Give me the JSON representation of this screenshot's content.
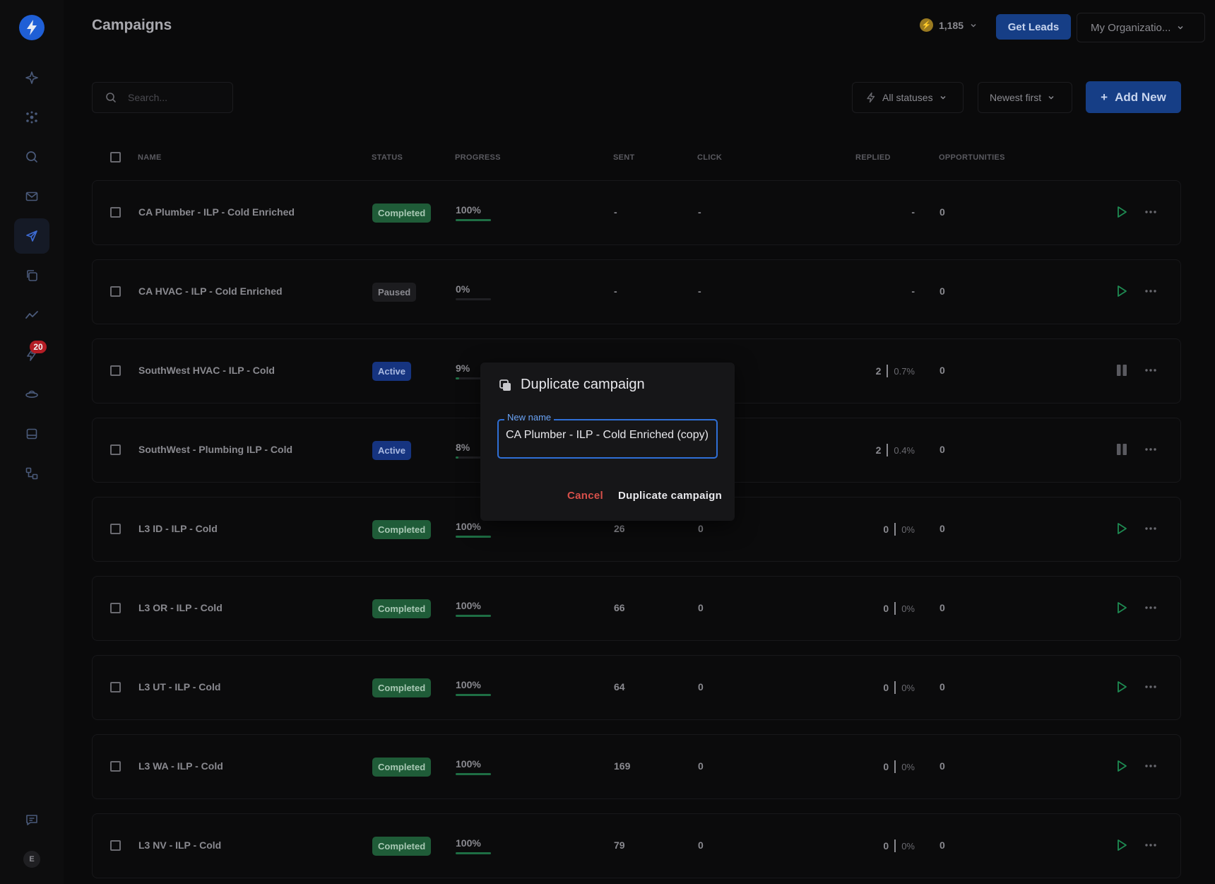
{
  "header": {
    "title": "Campaigns",
    "credits": "1,185",
    "get_leads_label": "Get Leads",
    "org_label": "My Organizatio..."
  },
  "sidebar": {
    "items": [
      {
        "icon": "sparkle-icon"
      },
      {
        "icon": "network-icon"
      },
      {
        "icon": "search-icon"
      },
      {
        "icon": "mail-icon"
      },
      {
        "icon": "send-icon",
        "active": true
      },
      {
        "icon": "copy-icon"
      },
      {
        "icon": "analytics-icon"
      },
      {
        "icon": "bolt-icon",
        "badge": "20"
      },
      {
        "icon": "ufo-icon"
      },
      {
        "icon": "inbox-icon"
      },
      {
        "icon": "workflow-icon"
      }
    ],
    "chat_icon": "chat-icon",
    "avatar_initial": "E"
  },
  "toolbar": {
    "search_placeholder": "Search...",
    "status_filter": "All statuses",
    "sort": "Newest first",
    "add_new_label": "Add New"
  },
  "table": {
    "columns": {
      "name": "NAME",
      "status": "STATUS",
      "progress": "PROGRESS",
      "sent": "SENT",
      "click": "CLICK",
      "replied": "REPLIED",
      "opportunities": "OPPORTUNITIES"
    },
    "rows": [
      {
        "name": "CA Plumber - ILP - Cold Enriched",
        "status": "Completed",
        "status_kind": "completed",
        "progress": "100%",
        "progress_value": 100,
        "sent": "-",
        "click": "-",
        "replied": "-",
        "replied_pct": "",
        "opportunities": "0",
        "action": "play"
      },
      {
        "name": "CA HVAC - ILP - Cold Enriched",
        "status": "Paused",
        "status_kind": "paused",
        "progress": "0%",
        "progress_value": 0,
        "sent": "-",
        "click": "-",
        "replied": "-",
        "replied_pct": "",
        "opportunities": "0",
        "action": "play"
      },
      {
        "name": "SouthWest HVAC - ILP - Cold",
        "status": "Active",
        "status_kind": "active",
        "progress": "9%",
        "progress_value": 9,
        "sent": "",
        "click": "",
        "replied": "2",
        "replied_pct": "0.7%",
        "opportunities": "0",
        "action": "pause"
      },
      {
        "name": "SouthWest - Plumbing ILP - Cold",
        "status": "Active",
        "status_kind": "active",
        "progress": "8%",
        "progress_value": 8,
        "sent": "",
        "click": "",
        "replied": "2",
        "replied_pct": "0.4%",
        "opportunities": "0",
        "action": "pause"
      },
      {
        "name": "L3 ID - ILP - Cold",
        "status": "Completed",
        "status_kind": "completed",
        "progress": "100%",
        "progress_value": 100,
        "sent": "26",
        "click": "0",
        "replied": "0",
        "replied_pct": "0%",
        "opportunities": "0",
        "action": "play"
      },
      {
        "name": "L3 OR - ILP - Cold",
        "status": "Completed",
        "status_kind": "completed",
        "progress": "100%",
        "progress_value": 100,
        "sent": "66",
        "click": "0",
        "replied": "0",
        "replied_pct": "0%",
        "opportunities": "0",
        "action": "play"
      },
      {
        "name": "L3 UT - ILP - Cold",
        "status": "Completed",
        "status_kind": "completed",
        "progress": "100%",
        "progress_value": 100,
        "sent": "64",
        "click": "0",
        "replied": "0",
        "replied_pct": "0%",
        "opportunities": "0",
        "action": "play"
      },
      {
        "name": "L3 WA - ILP - Cold",
        "status": "Completed",
        "status_kind": "completed",
        "progress": "100%",
        "progress_value": 100,
        "sent": "169",
        "click": "0",
        "replied": "0",
        "replied_pct": "0%",
        "opportunities": "0",
        "action": "play"
      },
      {
        "name": "L3 NV - ILP - Cold",
        "status": "Completed",
        "status_kind": "completed",
        "progress": "100%",
        "progress_value": 100,
        "sent": "79",
        "click": "0",
        "replied": "0",
        "replied_pct": "0%",
        "opportunities": "0",
        "action": "play"
      }
    ]
  },
  "modal": {
    "title": "Duplicate campaign",
    "field_label": "New name",
    "field_value": "CA Plumber - ILP - Cold Enriched (copy)",
    "cancel_label": "Cancel",
    "confirm_label": "Duplicate campaign"
  },
  "colors": {
    "accent": "#163e86",
    "completed": "#1f5c38",
    "active": "#163480",
    "danger": "#d8504a",
    "focus": "#2f6fd6"
  }
}
